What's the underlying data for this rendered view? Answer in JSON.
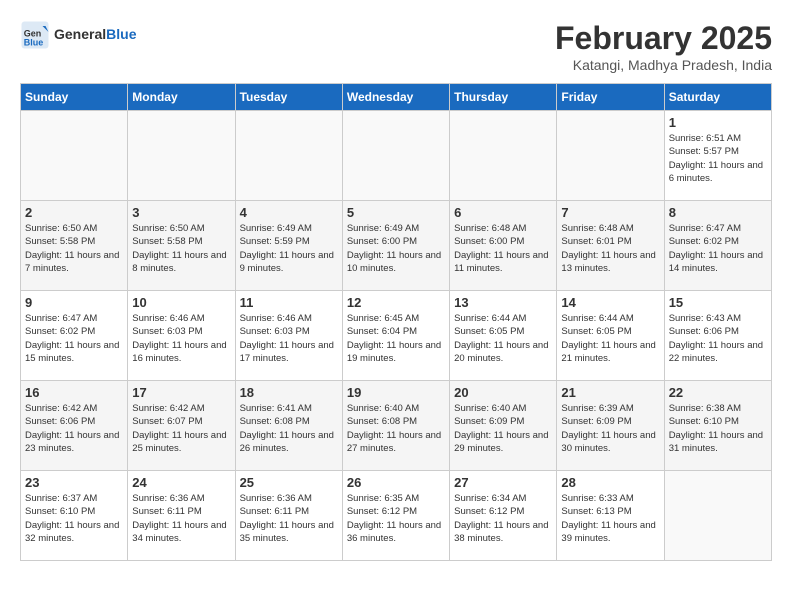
{
  "header": {
    "logo_text_general": "General",
    "logo_text_blue": "Blue",
    "month_year": "February 2025",
    "location": "Katangi, Madhya Pradesh, India"
  },
  "days_of_week": [
    "Sunday",
    "Monday",
    "Tuesday",
    "Wednesday",
    "Thursday",
    "Friday",
    "Saturday"
  ],
  "weeks": [
    [
      {
        "day": "",
        "info": ""
      },
      {
        "day": "",
        "info": ""
      },
      {
        "day": "",
        "info": ""
      },
      {
        "day": "",
        "info": ""
      },
      {
        "day": "",
        "info": ""
      },
      {
        "day": "",
        "info": ""
      },
      {
        "day": "1",
        "info": "Sunrise: 6:51 AM\nSunset: 5:57 PM\nDaylight: 11 hours and 6 minutes."
      }
    ],
    [
      {
        "day": "2",
        "info": "Sunrise: 6:50 AM\nSunset: 5:58 PM\nDaylight: 11 hours and 7 minutes."
      },
      {
        "day": "3",
        "info": "Sunrise: 6:50 AM\nSunset: 5:58 PM\nDaylight: 11 hours and 8 minutes."
      },
      {
        "day": "4",
        "info": "Sunrise: 6:49 AM\nSunset: 5:59 PM\nDaylight: 11 hours and 9 minutes."
      },
      {
        "day": "5",
        "info": "Sunrise: 6:49 AM\nSunset: 6:00 PM\nDaylight: 11 hours and 10 minutes."
      },
      {
        "day": "6",
        "info": "Sunrise: 6:48 AM\nSunset: 6:00 PM\nDaylight: 11 hours and 11 minutes."
      },
      {
        "day": "7",
        "info": "Sunrise: 6:48 AM\nSunset: 6:01 PM\nDaylight: 11 hours and 13 minutes."
      },
      {
        "day": "8",
        "info": "Sunrise: 6:47 AM\nSunset: 6:02 PM\nDaylight: 11 hours and 14 minutes."
      }
    ],
    [
      {
        "day": "9",
        "info": "Sunrise: 6:47 AM\nSunset: 6:02 PM\nDaylight: 11 hours and 15 minutes."
      },
      {
        "day": "10",
        "info": "Sunrise: 6:46 AM\nSunset: 6:03 PM\nDaylight: 11 hours and 16 minutes."
      },
      {
        "day": "11",
        "info": "Sunrise: 6:46 AM\nSunset: 6:03 PM\nDaylight: 11 hours and 17 minutes."
      },
      {
        "day": "12",
        "info": "Sunrise: 6:45 AM\nSunset: 6:04 PM\nDaylight: 11 hours and 19 minutes."
      },
      {
        "day": "13",
        "info": "Sunrise: 6:44 AM\nSunset: 6:05 PM\nDaylight: 11 hours and 20 minutes."
      },
      {
        "day": "14",
        "info": "Sunrise: 6:44 AM\nSunset: 6:05 PM\nDaylight: 11 hours and 21 minutes."
      },
      {
        "day": "15",
        "info": "Sunrise: 6:43 AM\nSunset: 6:06 PM\nDaylight: 11 hours and 22 minutes."
      }
    ],
    [
      {
        "day": "16",
        "info": "Sunrise: 6:42 AM\nSunset: 6:06 PM\nDaylight: 11 hours and 23 minutes."
      },
      {
        "day": "17",
        "info": "Sunrise: 6:42 AM\nSunset: 6:07 PM\nDaylight: 11 hours and 25 minutes."
      },
      {
        "day": "18",
        "info": "Sunrise: 6:41 AM\nSunset: 6:08 PM\nDaylight: 11 hours and 26 minutes."
      },
      {
        "day": "19",
        "info": "Sunrise: 6:40 AM\nSunset: 6:08 PM\nDaylight: 11 hours and 27 minutes."
      },
      {
        "day": "20",
        "info": "Sunrise: 6:40 AM\nSunset: 6:09 PM\nDaylight: 11 hours and 29 minutes."
      },
      {
        "day": "21",
        "info": "Sunrise: 6:39 AM\nSunset: 6:09 PM\nDaylight: 11 hours and 30 minutes."
      },
      {
        "day": "22",
        "info": "Sunrise: 6:38 AM\nSunset: 6:10 PM\nDaylight: 11 hours and 31 minutes."
      }
    ],
    [
      {
        "day": "23",
        "info": "Sunrise: 6:37 AM\nSunset: 6:10 PM\nDaylight: 11 hours and 32 minutes."
      },
      {
        "day": "24",
        "info": "Sunrise: 6:36 AM\nSunset: 6:11 PM\nDaylight: 11 hours and 34 minutes."
      },
      {
        "day": "25",
        "info": "Sunrise: 6:36 AM\nSunset: 6:11 PM\nDaylight: 11 hours and 35 minutes."
      },
      {
        "day": "26",
        "info": "Sunrise: 6:35 AM\nSunset: 6:12 PM\nDaylight: 11 hours and 36 minutes."
      },
      {
        "day": "27",
        "info": "Sunrise: 6:34 AM\nSunset: 6:12 PM\nDaylight: 11 hours and 38 minutes."
      },
      {
        "day": "28",
        "info": "Sunrise: 6:33 AM\nSunset: 6:13 PM\nDaylight: 11 hours and 39 minutes."
      },
      {
        "day": "",
        "info": ""
      }
    ]
  ]
}
